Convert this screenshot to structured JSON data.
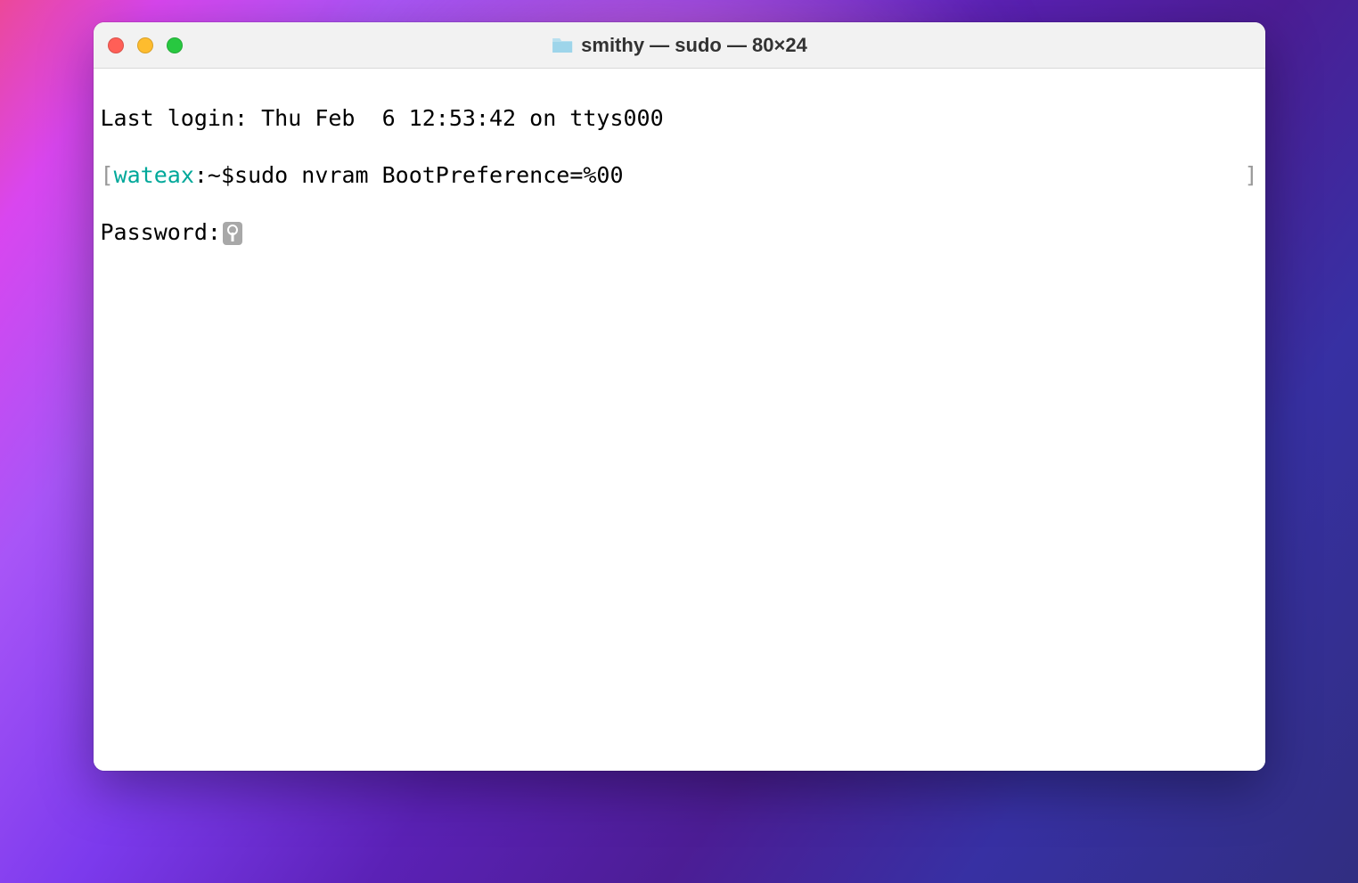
{
  "window": {
    "title": "smithy — sudo — 80×24"
  },
  "terminal": {
    "last_login": "Last login: Thu Feb  6 12:53:42 on ttys000",
    "prompt_bracket_left": "[",
    "prompt_bracket_right": "]",
    "hostname": "wateax",
    "prompt_separator": ":~$",
    "command": "sudo nvram BootPreference=%00",
    "password_prompt": "Password:"
  }
}
